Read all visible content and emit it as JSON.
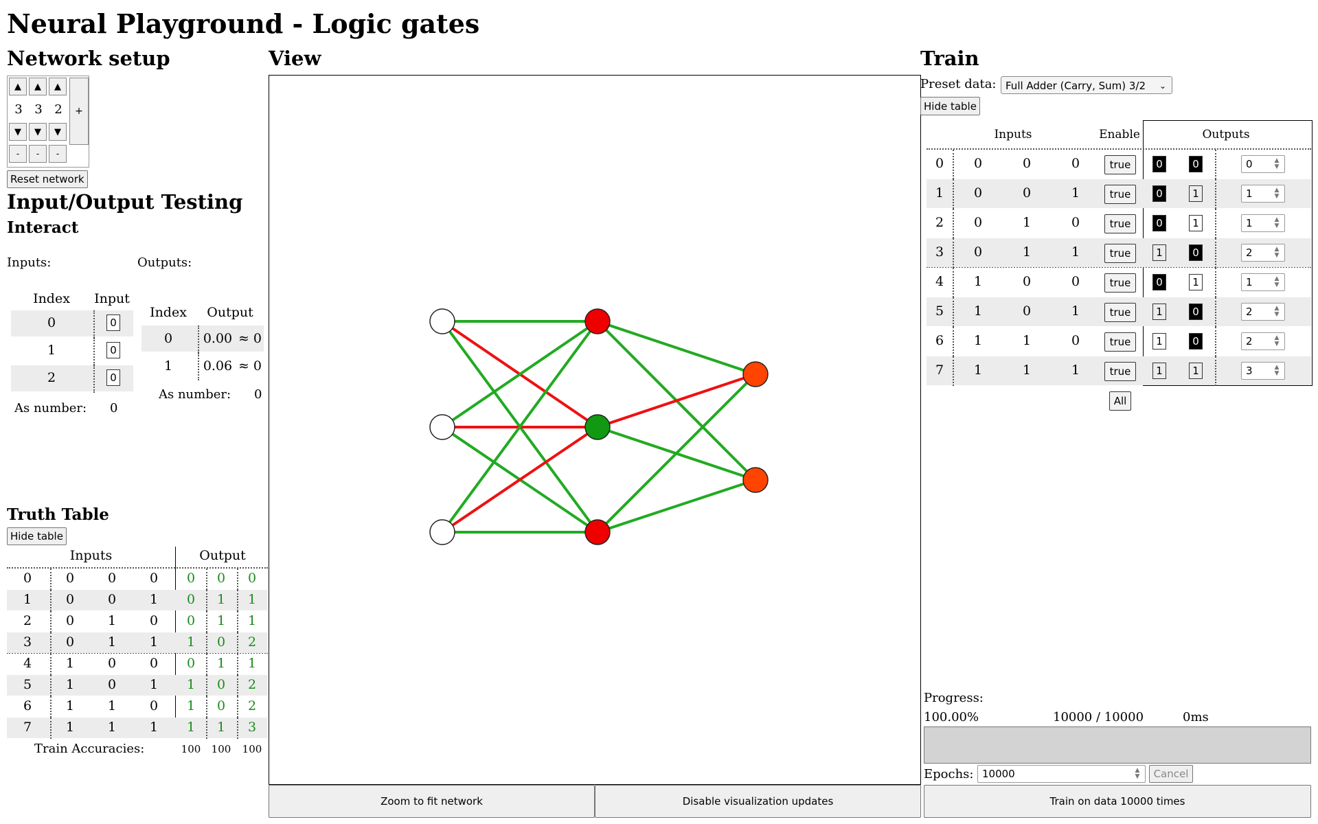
{
  "title": "Neural Playground - Logic gates",
  "network_setup": {
    "heading": "Network setup",
    "layers": [
      3,
      3,
      2
    ],
    "up_icon": "▲",
    "down_icon": "▼",
    "remove_label": "-",
    "add_label": "+",
    "reset_label": "Reset network"
  },
  "io": {
    "heading": "Input/Output Testing",
    "subheading": "Interact",
    "inputs_label": "Inputs:",
    "outputs_label": "Outputs:",
    "input_headers": [
      "Index",
      "Input"
    ],
    "input_rows": [
      {
        "index": "0",
        "value": "0"
      },
      {
        "index": "1",
        "value": "0"
      },
      {
        "index": "2",
        "value": "0"
      }
    ],
    "input_as_number_label": "As number:",
    "input_as_number": "0",
    "output_headers": [
      "Index",
      "Output"
    ],
    "output_rows": [
      {
        "index": "0",
        "value": "0.00",
        "approx": "≈ 0"
      },
      {
        "index": "1",
        "value": "0.06",
        "approx": "≈ 0"
      }
    ],
    "output_as_number_label": "As number:",
    "output_as_number": "0"
  },
  "truth_table": {
    "heading": "Truth Table",
    "hide_label": "Hide table",
    "inputs_header": "Inputs",
    "output_header": "Output",
    "rows": [
      {
        "i": "0",
        "in": [
          "0",
          "0",
          "0"
        ],
        "out": [
          "0",
          "0",
          "0"
        ]
      },
      {
        "i": "1",
        "in": [
          "0",
          "0",
          "1"
        ],
        "out": [
          "0",
          "1",
          "1"
        ]
      },
      {
        "i": "2",
        "in": [
          "0",
          "1",
          "0"
        ],
        "out": [
          "0",
          "1",
          "1"
        ]
      },
      {
        "i": "3",
        "in": [
          "0",
          "1",
          "1"
        ],
        "out": [
          "1",
          "0",
          "2"
        ]
      },
      {
        "i": "4",
        "in": [
          "1",
          "0",
          "0"
        ],
        "out": [
          "0",
          "1",
          "1"
        ]
      },
      {
        "i": "5",
        "in": [
          "1",
          "0",
          "1"
        ],
        "out": [
          "1",
          "0",
          "2"
        ]
      },
      {
        "i": "6",
        "in": [
          "1",
          "1",
          "0"
        ],
        "out": [
          "1",
          "0",
          "2"
        ]
      },
      {
        "i": "7",
        "in": [
          "1",
          "1",
          "1"
        ],
        "out": [
          "1",
          "1",
          "3"
        ]
      }
    ],
    "accuracies_label": "Train Accuracies:",
    "accuracies": [
      "100",
      "100",
      "100"
    ]
  },
  "view": {
    "heading": "View",
    "zoom_label": "Zoom to fit network",
    "disable_label": "Disable visualization updates",
    "colors": {
      "positive": "#22aa22",
      "negative": "#ee1111",
      "node_red": "#ee0000",
      "node_green": "#119911",
      "node_orange": "#ff4400",
      "node_white": "#ffffff"
    }
  },
  "train": {
    "heading": "Train",
    "preset_label": "Preset data:",
    "preset_value": "Full Adder (Carry, Sum) 3/2",
    "hide_label": "Hide table",
    "inputs_header": "Inputs",
    "enable_header": "Enable",
    "outputs_header": "Outputs",
    "rows": [
      {
        "i": "0",
        "in": [
          "0",
          "0",
          "0"
        ],
        "enable": "true",
        "out": [
          "0",
          "0"
        ],
        "num": "0"
      },
      {
        "i": "1",
        "in": [
          "0",
          "0",
          "1"
        ],
        "enable": "true",
        "out": [
          "0",
          "1"
        ],
        "num": "1"
      },
      {
        "i": "2",
        "in": [
          "0",
          "1",
          "0"
        ],
        "enable": "true",
        "out": [
          "0",
          "1"
        ],
        "num": "1"
      },
      {
        "i": "3",
        "in": [
          "0",
          "1",
          "1"
        ],
        "enable": "true",
        "out": [
          "1",
          "0"
        ],
        "num": "2"
      },
      {
        "i": "4",
        "in": [
          "1",
          "0",
          "0"
        ],
        "enable": "true",
        "out": [
          "0",
          "1"
        ],
        "num": "1"
      },
      {
        "i": "5",
        "in": [
          "1",
          "0",
          "1"
        ],
        "enable": "true",
        "out": [
          "1",
          "0"
        ],
        "num": "2"
      },
      {
        "i": "6",
        "in": [
          "1",
          "1",
          "0"
        ],
        "enable": "true",
        "out": [
          "1",
          "0"
        ],
        "num": "2"
      },
      {
        "i": "7",
        "in": [
          "1",
          "1",
          "1"
        ],
        "enable": "true",
        "out": [
          "1",
          "1"
        ],
        "num": "3"
      }
    ],
    "all_label": "All",
    "progress_label": "Progress:",
    "progress_percent": "100.00%",
    "progress_fraction": 1.0,
    "progress_count": "10000 / 10000",
    "progress_time": "0ms",
    "epochs_label": "Epochs:",
    "epochs_value": "10000",
    "cancel_label": "Cancel",
    "train_label": "Train on data 10000 times"
  }
}
